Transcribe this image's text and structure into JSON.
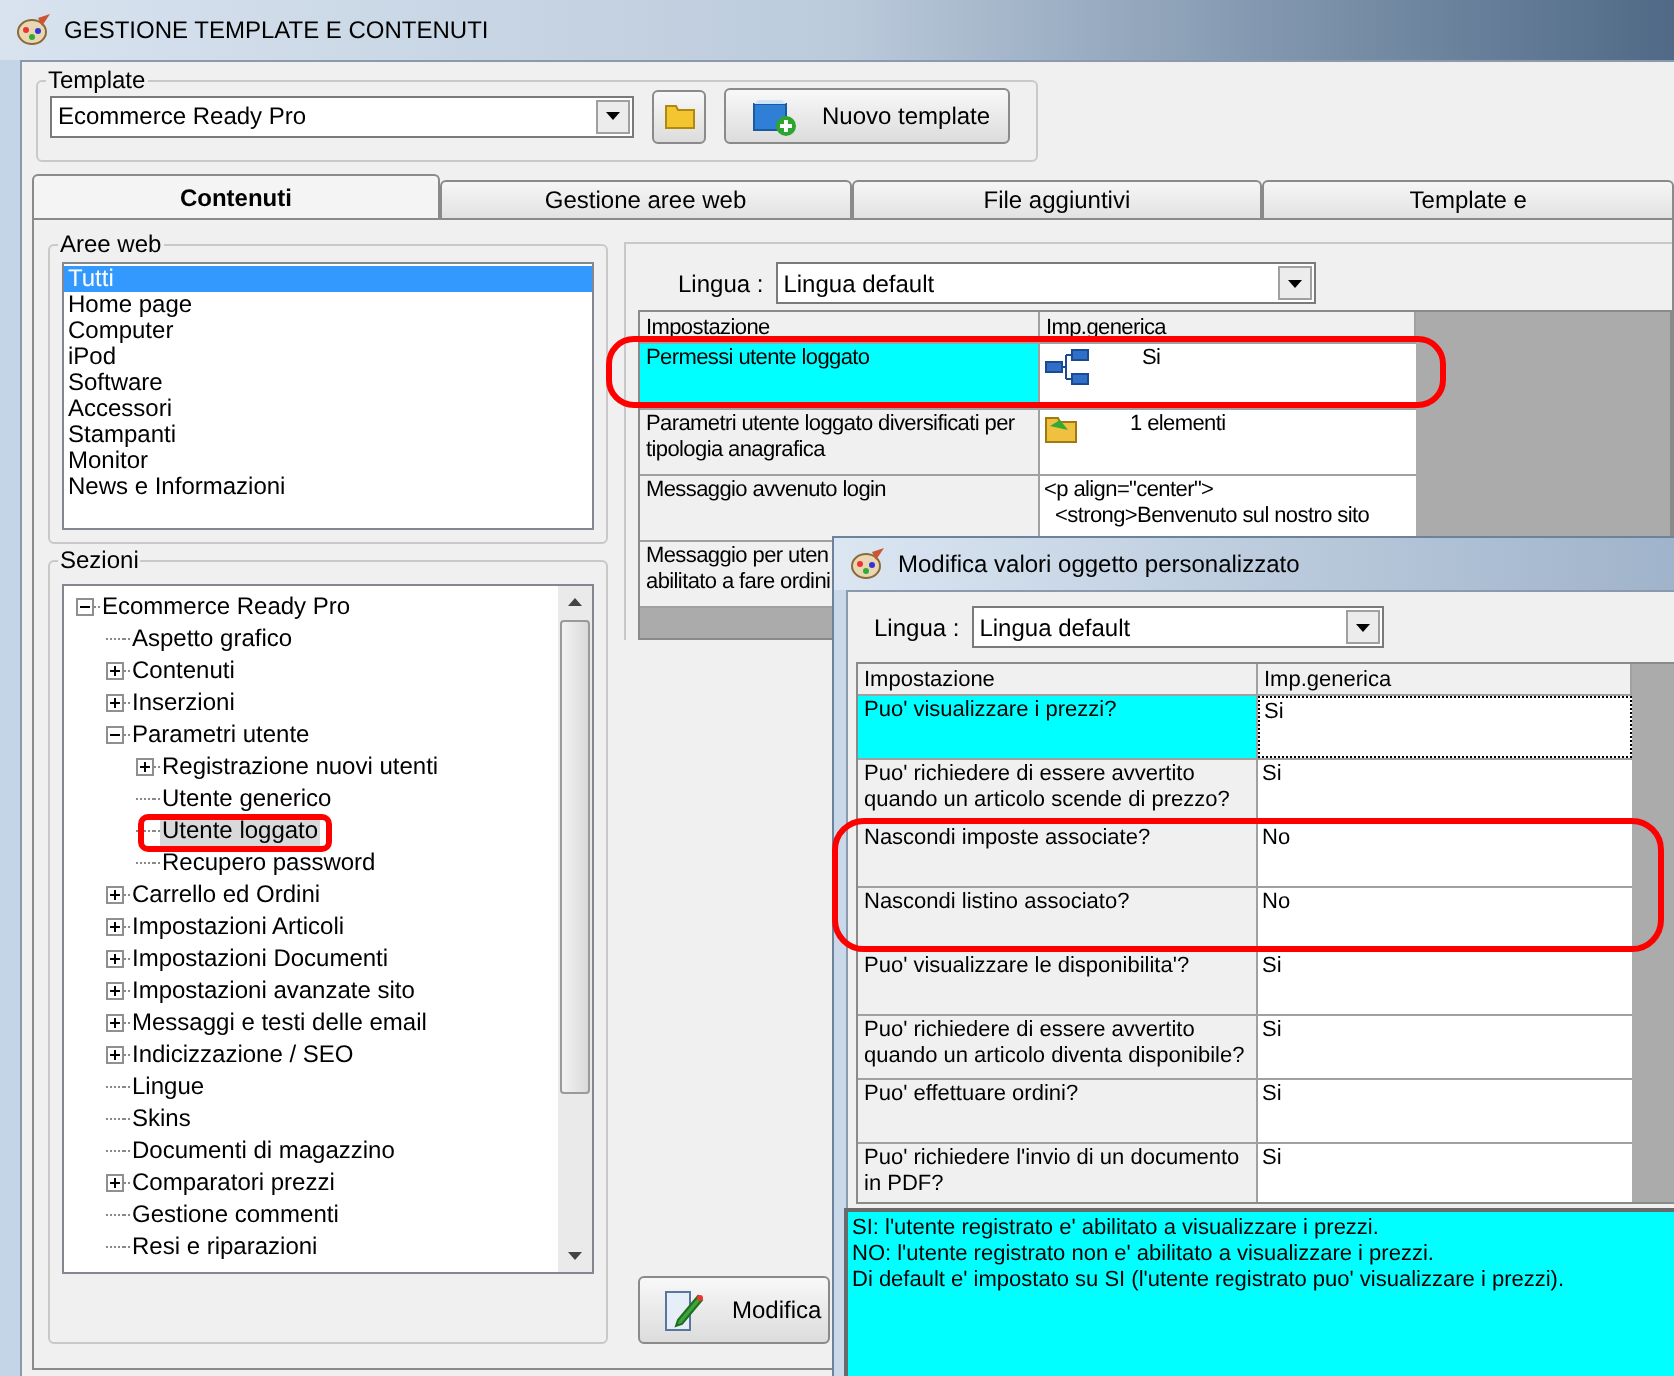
{
  "window": {
    "title": "GESTIONE TEMPLATE E CONTENUTI"
  },
  "template": {
    "label": "Template",
    "value": "Ecommerce Ready Pro",
    "new_button": "Nuovo template"
  },
  "tabs": [
    {
      "label": "Contenuti",
      "selected": true
    },
    {
      "label": "Gestione aree web",
      "selected": false
    },
    {
      "label": "File aggiuntivi",
      "selected": false
    },
    {
      "label": "Template e",
      "selected": false
    }
  ],
  "web_areas": {
    "label": "Aree web",
    "items": [
      {
        "label": "Tutti",
        "selected": true
      },
      {
        "label": "Home page",
        "selected": false
      },
      {
        "label": "Computer",
        "selected": false
      },
      {
        "label": "iPod",
        "selected": false
      },
      {
        "label": "Software",
        "selected": false
      },
      {
        "label": "Accessori",
        "selected": false
      },
      {
        "label": "Stampanti",
        "selected": false
      },
      {
        "label": "Monitor",
        "selected": false
      },
      {
        "label": "News e Informazioni",
        "selected": false
      }
    ]
  },
  "sections": {
    "label": "Sezioni",
    "tree": [
      {
        "label": "Ecommerce Ready Pro",
        "expanded": true,
        "selected": false,
        "children": [
          {
            "label": "Aspetto grafico",
            "selected": false
          },
          {
            "label": "Contenuti",
            "expanded": false,
            "selected": false
          },
          {
            "label": "Inserzioni",
            "expanded": false,
            "selected": false
          },
          {
            "label": "Parametri utente",
            "expanded": true,
            "selected": false,
            "children": [
              {
                "label": "Registrazione nuovi utenti",
                "expanded": false,
                "selected": false
              },
              {
                "label": "Utente generico",
                "selected": false
              },
              {
                "label": "Utente loggato",
                "selected": true
              },
              {
                "label": "Recupero password",
                "selected": false
              }
            ]
          },
          {
            "label": "Carrello ed Ordini",
            "expanded": false,
            "selected": false
          },
          {
            "label": "Impostazioni Articoli",
            "expanded": false,
            "selected": false
          },
          {
            "label": "Impostazioni Documenti",
            "expanded": false,
            "selected": false
          },
          {
            "label": "Impostazioni avanzate sito",
            "expanded": false,
            "selected": false
          },
          {
            "label": "Messaggi e testi delle email",
            "expanded": false,
            "selected": false
          },
          {
            "label": "Indicizzazione / SEO",
            "expanded": false,
            "selected": false
          },
          {
            "label": "Lingue",
            "selected": false
          },
          {
            "label": "Skins",
            "selected": false
          },
          {
            "label": "Documenti di magazzino",
            "selected": false
          },
          {
            "label": "Comparatori prezzi",
            "expanded": false,
            "selected": false
          },
          {
            "label": "Gestione commenti",
            "selected": false
          },
          {
            "label": "Resi e riparazioni",
            "selected": false
          }
        ]
      }
    ]
  },
  "language": {
    "label": "Lingua :",
    "value": "Lingua default"
  },
  "settings_grid": {
    "columns": [
      "Impostazione",
      "Imp.generica"
    ],
    "rows": [
      {
        "label": "Permessi utente loggato",
        "value": "Si",
        "kind": "object",
        "selected": true
      },
      {
        "label": "Parametri utente loggato diversificati per tipologia anagrafica",
        "value": "1 elementi",
        "kind": "list",
        "selected": false
      },
      {
        "label": "Messaggio avvenuto login",
        "value": "<p align=\"center\">\n  <strong>Benvenuto sul nostro sito",
        "kind": "text",
        "selected": false
      },
      {
        "label": "Messaggio per uten\nabilitato a fare ordini",
        "kind": "text",
        "selected": false
      }
    ]
  },
  "edit_button": "Modifica",
  "dialog": {
    "title": "Modifica valori oggetto personalizzato",
    "language": {
      "label": "Lingua :",
      "value": "Lingua default"
    },
    "columns": [
      "Impostazione",
      "Imp.generica"
    ],
    "rows": [
      {
        "label": "Puo' visualizzare i prezzi?",
        "value": "Si",
        "selected": true
      },
      {
        "label": "Puo' richiedere di essere avvertito quando un articolo scende di prezzo?",
        "value": "Si",
        "selected": false
      },
      {
        "label": "Nascondi imposte associate?",
        "value": "No",
        "selected": false
      },
      {
        "label": "Nascondi listino associato?",
        "value": "No",
        "selected": false
      },
      {
        "label": "Puo' visualizzare le disponibilita'?",
        "value": "Si",
        "selected": false
      },
      {
        "label": "Puo' richiedere di essere avvertito quando un articolo diventa disponibile?",
        "value": "Si",
        "selected": false
      },
      {
        "label": "Puo' effettuare ordini?",
        "value": "Si",
        "selected": false
      },
      {
        "label": "Puo' richiedere l'invio di un documento in PDF?",
        "value": "Si",
        "selected": false
      }
    ],
    "description": [
      "SI: l'utente registrato e' abilitato a visualizzare i prezzi.",
      "NO: l'utente registrato non e' abilitato a visualizzare i prezzi.",
      "Di default e' impostato su SI (l'utente registrato puo' visualizzare i prezzi)."
    ]
  }
}
